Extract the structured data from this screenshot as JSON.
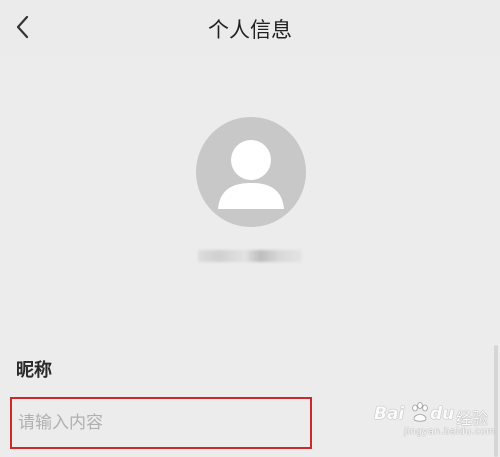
{
  "header": {
    "title": "个人信息"
  },
  "form": {
    "nickname_label": "昵称",
    "nickname_placeholder": "请输入内容",
    "nickname_value": ""
  },
  "watermark": {
    "brand_left": "Bai",
    "brand_right": "du",
    "brand_cn": "经验",
    "url": "jingyan.baidu.com"
  },
  "colors": {
    "highlight_border": "#cc2a2a",
    "avatar_bg": "#c8c8c8",
    "page_bg": "#ececec"
  },
  "icons": {
    "back": "chevron-left-icon",
    "avatar": "default-user-avatar-icon",
    "watermark_logo": "baidu-paw-icon"
  }
}
